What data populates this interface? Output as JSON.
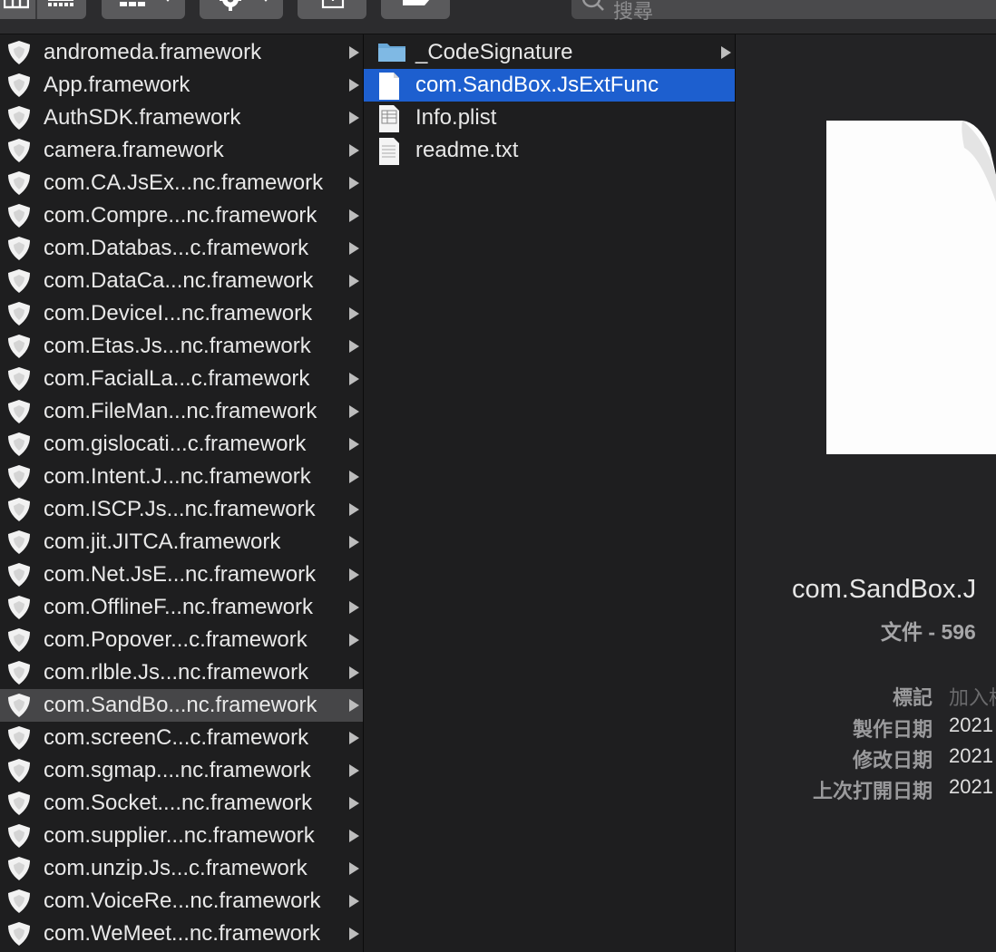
{
  "search": {
    "placeholder": "搜尋"
  },
  "column1": {
    "items": [
      {
        "label": "andromeda.framework"
      },
      {
        "label": "App.framework"
      },
      {
        "label": "AuthSDK.framework"
      },
      {
        "label": "camera.framework"
      },
      {
        "label": "com.CA.JsEx...nc.framework"
      },
      {
        "label": "com.Compre...nc.framework"
      },
      {
        "label": "com.Databas...c.framework"
      },
      {
        "label": "com.DataCa...nc.framework"
      },
      {
        "label": "com.DeviceI...nc.framework"
      },
      {
        "label": "com.Etas.Js...nc.framework"
      },
      {
        "label": "com.FacialLa...c.framework"
      },
      {
        "label": "com.FileMan...nc.framework"
      },
      {
        "label": "com.gislocati...c.framework"
      },
      {
        "label": "com.Intent.J...nc.framework"
      },
      {
        "label": "com.ISCP.Js...nc.framework"
      },
      {
        "label": "com.jit.JITCA.framework"
      },
      {
        "label": "com.Net.JsE...nc.framework"
      },
      {
        "label": "com.OfflineF...nc.framework"
      },
      {
        "label": "com.Popover...c.framework"
      },
      {
        "label": "com.rlble.Js...nc.framework"
      },
      {
        "label": "com.SandBo...nc.framework"
      },
      {
        "label": "com.screenC...c.framework"
      },
      {
        "label": "com.sgmap....nc.framework"
      },
      {
        "label": "com.Socket....nc.framework"
      },
      {
        "label": "com.supplier...nc.framework"
      },
      {
        "label": "com.unzip.Js...c.framework"
      },
      {
        "label": "com.VoiceRe...nc.framework"
      },
      {
        "label": "com.WeMeet...nc.framework"
      }
    ]
  },
  "column2": {
    "items": [
      {
        "label": "_CodeSignature",
        "icon": "folder-icon"
      },
      {
        "label": "com.SandBox.JsExtFunc",
        "icon": "document-icon"
      },
      {
        "label": "Info.plist",
        "icon": "plist-file-icon"
      },
      {
        "label": "readme.txt",
        "icon": "text-file-icon"
      }
    ]
  },
  "preview": {
    "name": "com.SandBox.J",
    "kind": "文件 - 596",
    "tags_label": "標記",
    "tags_value": "加入標",
    "created_label": "製作日期",
    "created_value": "2021",
    "modified_label": "修改日期",
    "modified_value": "2021",
    "opened_label": "上次打開日期",
    "opened_value": "2021"
  },
  "colors": {
    "selection": "#1d5fcf",
    "highlight": "#464648"
  }
}
